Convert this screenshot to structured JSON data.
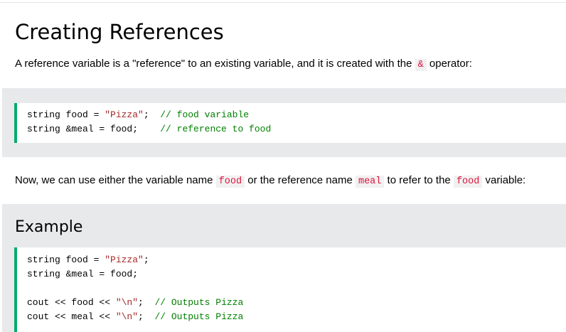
{
  "heading": "Creating References",
  "intro": {
    "text_before": "A reference variable is a \"reference\" to an existing variable, and it is created with the ",
    "operator": "&",
    "text_after": " operator:"
  },
  "code1": {
    "line1": {
      "a": "string food = ",
      "s": "\"Pizza\"",
      "b": ";  ",
      "c": "// food variable"
    },
    "line2": {
      "a": "string &meal = food;    ",
      "c": "// reference to food"
    }
  },
  "para2": {
    "t1": "Now, we can use either the variable name ",
    "c1": "food",
    "t2": " or the reference name ",
    "c2": "meal",
    "t3": " to refer to the ",
    "c3": "food",
    "t4": " variable:"
  },
  "example": {
    "title": "Example",
    "line1": {
      "a": "string food = ",
      "s": "\"Pizza\"",
      "b": ";"
    },
    "line2": {
      "a": "string &meal = food;"
    },
    "line3": {
      "a": "cout << food << ",
      "s": "\"\\n\"",
      "b": ";  ",
      "c": "// Outputs Pizza"
    },
    "line4": {
      "a": "cout << meal << ",
      "s": "\"\\n\"",
      "b": ";  ",
      "c": "// Outputs Pizza"
    }
  },
  "colors": {
    "accent": "#04aa6d",
    "panel_bg": "#e7e9eb",
    "inline_code": "#dc143c",
    "string": "#a52a2a",
    "comment": "#008000"
  }
}
